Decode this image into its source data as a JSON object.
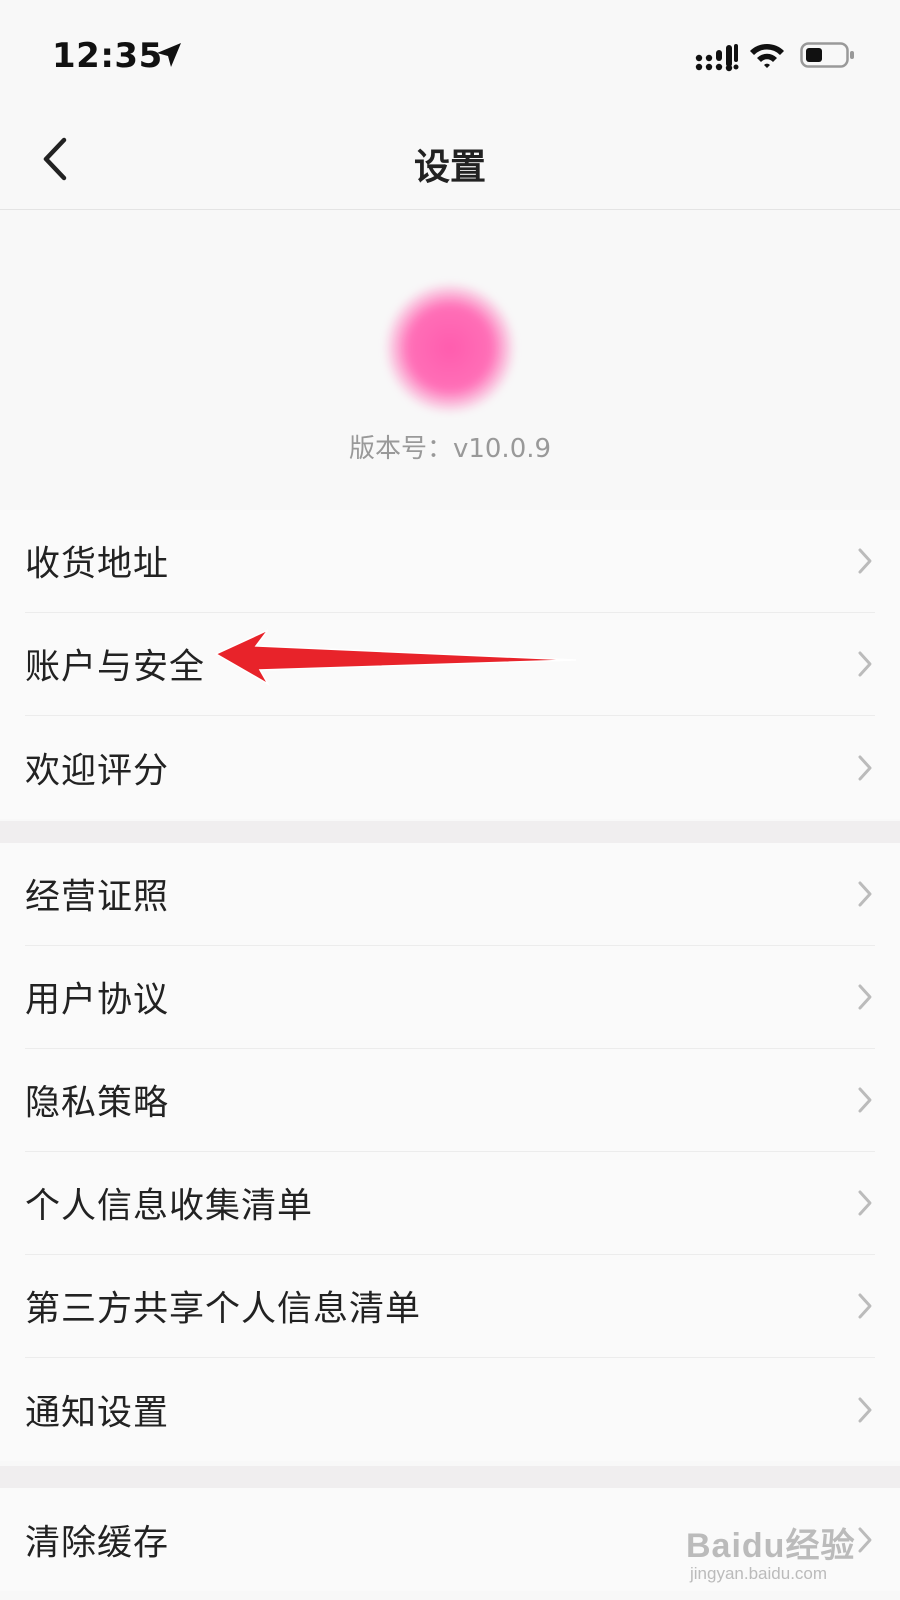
{
  "status_bar": {
    "time": "12:35"
  },
  "header": {
    "title": "设置"
  },
  "app_info": {
    "version_text": "版本号：v10.0.9",
    "logo_color": "#ff69b4"
  },
  "groups": [
    {
      "items": [
        {
          "label": "收货地址"
        },
        {
          "label": "账户与安全"
        },
        {
          "label": "欢迎评分"
        }
      ]
    },
    {
      "items": [
        {
          "label": "经营证照"
        },
        {
          "label": "用户协议"
        },
        {
          "label": "隐私策略"
        },
        {
          "label": "个人信息收集清单"
        },
        {
          "label": "第三方共享个人信息清单"
        },
        {
          "label": "通知设置"
        }
      ]
    },
    {
      "items": [
        {
          "label": "清除缓存"
        }
      ]
    }
  ],
  "annotation": {
    "arrow_color": "#e8232a"
  },
  "watermark": {
    "main": "Baidu经验",
    "sub": "jingyan.baidu.com"
  }
}
